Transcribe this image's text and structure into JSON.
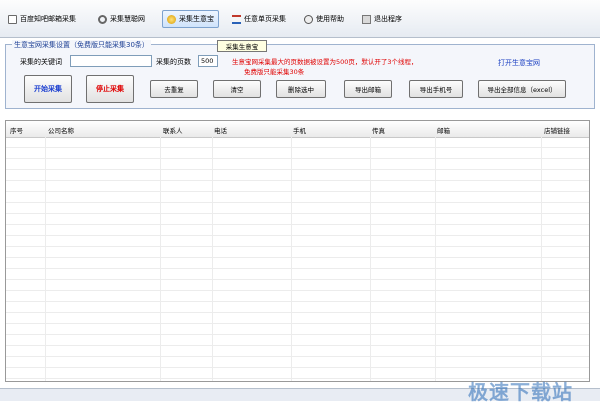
{
  "toolbar": {
    "items": [
      {
        "label": "百度知吧邮箱采集",
        "icon": "doc-icon"
      },
      {
        "label": "采集慧聪网",
        "icon": "gear-icon"
      },
      {
        "label": "采集生意宝",
        "icon": "star-icon"
      },
      {
        "label": "任意单页采集",
        "icon": "list-icon"
      },
      {
        "label": "使用帮助",
        "icon": "help-icon"
      },
      {
        "label": "退出程序",
        "icon": "exit-icon"
      }
    ],
    "tooltip": "采集生意宝"
  },
  "panel": {
    "title": "生意宝网采集设置（免费版只能采集30条）",
    "keyword_label": "采集的关键词",
    "keyword_value": "",
    "pages_label": "采集的页数",
    "pages_value": "500",
    "notice_line1": "生意宝网采集最大的页数据被设置为500页，默认开了3个线程，",
    "notice_line2": "免费版只能采集30条",
    "open_link": "打开生意宝网",
    "buttons": {
      "start": "开始采集",
      "stop": "停止采集",
      "dedupe": "去重复",
      "clear": "清空",
      "delete": "删除选中",
      "export_email": "导出邮箱",
      "export_phone": "导出手机号",
      "export_all": "导出全部信息（excel）"
    }
  },
  "table": {
    "columns": [
      "序号",
      "公司名称",
      "联系人",
      "电话",
      "手机",
      "传真",
      "邮箱",
      "店铺链接"
    ]
  },
  "watermark": "极速下载站",
  "colors": {
    "start": "#1c3fd0",
    "stop": "#e00000",
    "warn": "#e00000",
    "link": "#1a3fc2"
  }
}
